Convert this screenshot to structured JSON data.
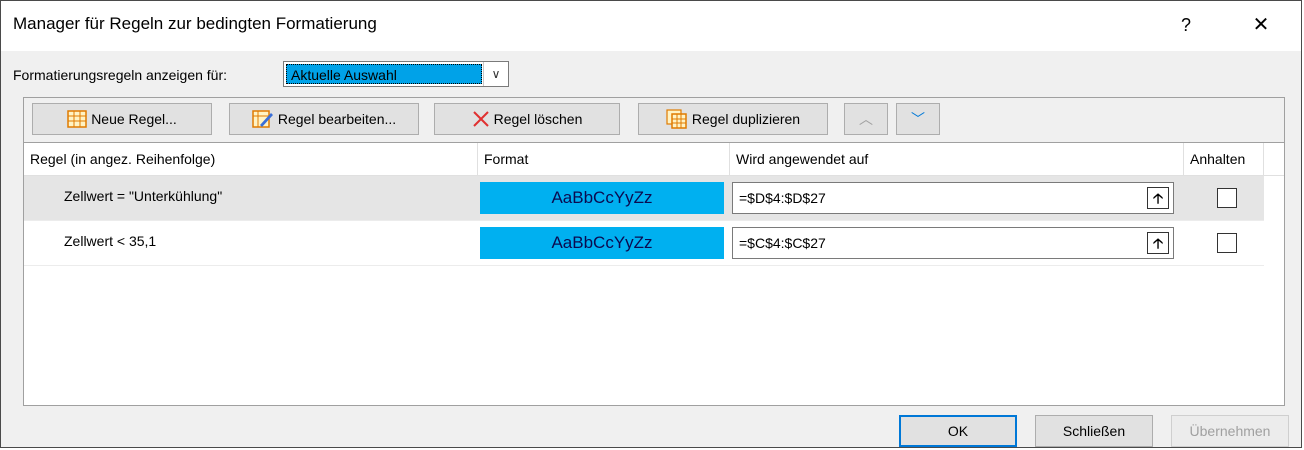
{
  "window": {
    "title": "Manager für Regeln zur bedingten Formatierung",
    "help": "?",
    "close": "✕"
  },
  "scope": {
    "label": "Formatierungsregeln anzeigen für:",
    "selected": "Aktuelle Auswahl"
  },
  "toolbar": {
    "new_rule": "Neue Regel...",
    "edit_rule": "Regel bearbeiten...",
    "delete_rule": "Regel löschen",
    "duplicate_rule": "Regel duplizieren",
    "move_up": "︿",
    "move_down": "﹀"
  },
  "table": {
    "headers": {
      "rule": "Regel (in angez. Reihenfolge)",
      "format": "Format",
      "applies_to": "Wird angewendet auf",
      "stop": "Anhalten"
    },
    "rows": [
      {
        "rule": "Zellwert = \"Unterkühlung\"",
        "format_preview": "AaBbCcYyZz",
        "applies_to": "=$D$4:$D$27",
        "selected": true
      },
      {
        "rule": "Zellwert < 35,1",
        "format_preview": "AaBbCcYyZz",
        "applies_to": "=$C$4:$C$27",
        "selected": false
      }
    ]
  },
  "footer": {
    "ok": "OK",
    "close": "Schließen",
    "apply": "Übernehmen"
  },
  "colors": {
    "format_fill": "#00b0f0",
    "selection": "#00a2e8"
  }
}
